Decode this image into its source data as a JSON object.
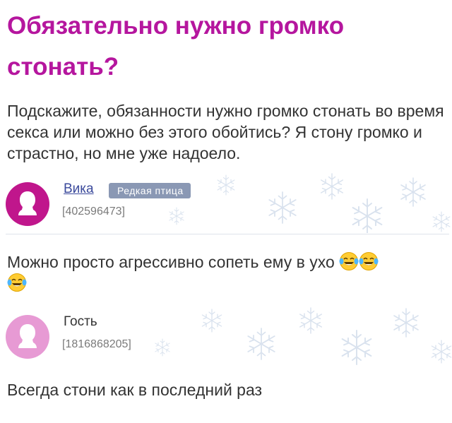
{
  "question": {
    "title": "Обязательно нужно громко стонать?",
    "text": "Подскажите, обязанности нужно громко стонать во время секса или можно без этого обойтись? Я стону громко и страстно, но мне уже надоело."
  },
  "answers": [
    {
      "user": {
        "name": "Вика",
        "badge": "Редкая птица",
        "id": "[402596473]",
        "avatar_color": "#c0168c"
      },
      "text": "Можно просто агрессивно сопеть ему в ухо",
      "emoji": [
        "face-with-tears-of-joy-icon",
        "face-with-tears-of-joy-icon",
        "face-with-tears-of-joy-icon"
      ]
    },
    {
      "user": {
        "name": "Гость",
        "id": "[1816868205]",
        "avatar_color": "#e79ad4"
      },
      "text": "Всегда стони как в последний раз"
    }
  ],
  "colors": {
    "title": "#b5169e",
    "badge": "#8a98b4",
    "snow": "#d9e2ee"
  }
}
